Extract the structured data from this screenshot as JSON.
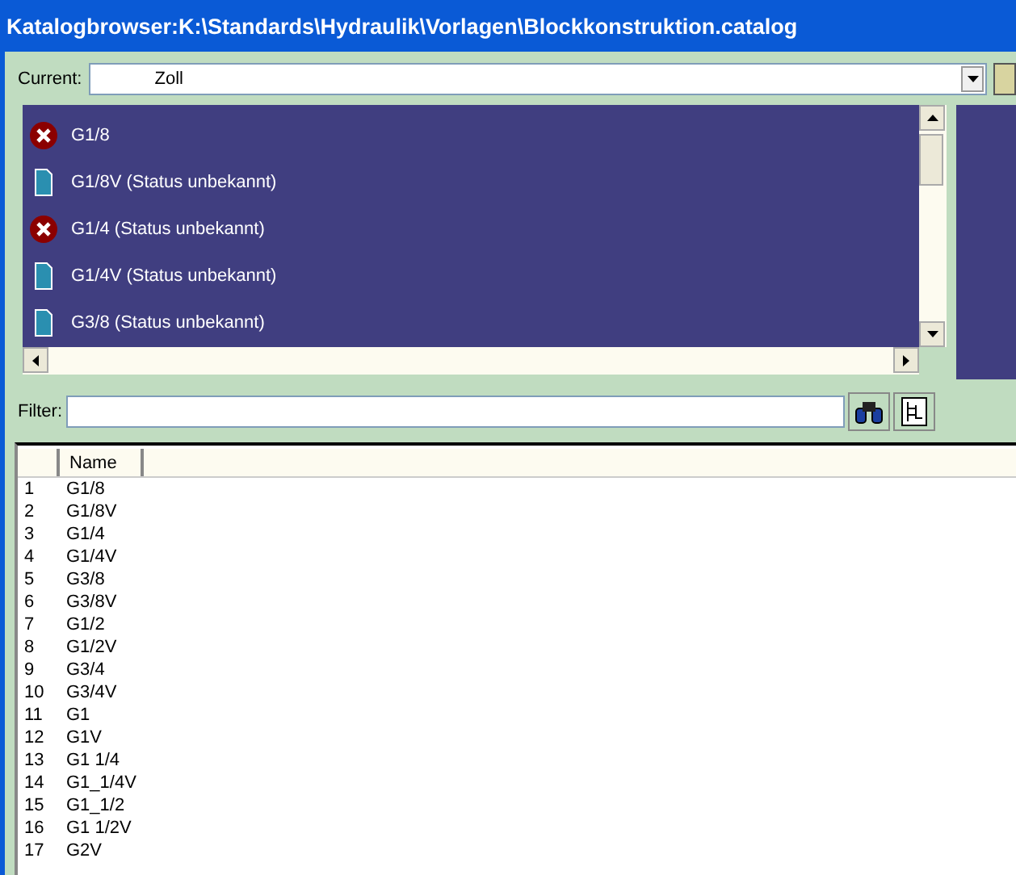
{
  "window": {
    "title": "Katalogbrowser:K:\\Standards\\Hydraulik\\Vorlagen\\Blockkonstruktion.catalog"
  },
  "current": {
    "label": "Current:",
    "value": "Zoll"
  },
  "items": [
    {
      "kind": "error",
      "label": "G1/8",
      "selected": true
    },
    {
      "kind": "document",
      "label": "G1/8V (Status unbekannt)",
      "selected": true
    },
    {
      "kind": "error",
      "label": "G1/4 (Status unbekannt)",
      "selected": true
    },
    {
      "kind": "document",
      "label": "G1/4V (Status unbekannt)",
      "selected": true
    },
    {
      "kind": "document",
      "label": "G3/8 (Status unbekannt)",
      "selected": true
    }
  ],
  "filter": {
    "label": "Filter:"
  },
  "table": {
    "columns": [
      "",
      "Name"
    ],
    "rows": [
      [
        "1",
        "G1/8"
      ],
      [
        "2",
        "G1/8V"
      ],
      [
        "3",
        "G1/4"
      ],
      [
        "4",
        "G1/4V"
      ],
      [
        "5",
        "G3/8"
      ],
      [
        "6",
        "G3/8V"
      ],
      [
        "7",
        "G1/2"
      ],
      [
        "8",
        "G1/2V"
      ],
      [
        "9",
        "G3/4"
      ],
      [
        "10",
        "G3/4V"
      ],
      [
        "11",
        "G1"
      ],
      [
        "12",
        "G1V"
      ],
      [
        "13",
        "G1 1/4"
      ],
      [
        "14",
        "G1_1/4V"
      ],
      [
        "15",
        "G1_1/2"
      ],
      [
        "16",
        "G1 1/2V"
      ],
      [
        "17",
        "G2V"
      ]
    ]
  }
}
